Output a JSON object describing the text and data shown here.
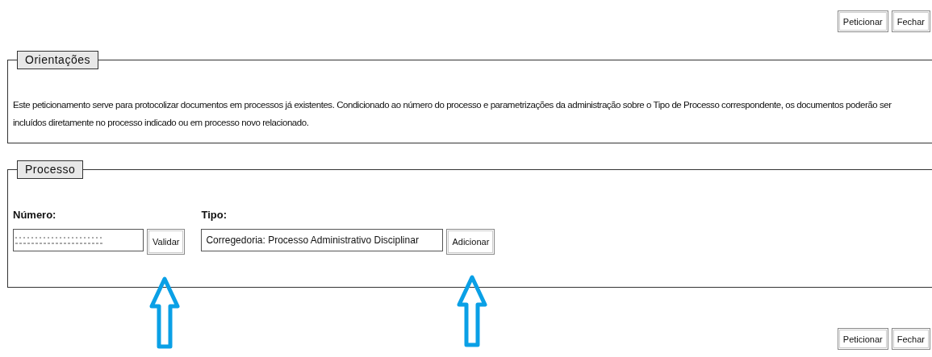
{
  "top_actions": [
    {
      "label": "Peticionar"
    },
    {
      "label": "Fechar"
    }
  ],
  "orientacoes": {
    "legend": "Orientações",
    "text": "Este peticionamento serve para protocolizar documentos em processos já existentes. Condicionado ao número do processo e parametrizações da administração sobre o Tipo de Processo correspondente, os documentos poderão ser incluídos diretamente no processo indicado ou em processo novo relacionado."
  },
  "processo": {
    "legend": "Processo",
    "numero": {
      "label": "Número:",
      "button": "Validar"
    },
    "tipo": {
      "label": "Tipo:",
      "value": "Corregedoria: Processo Administrativo Disciplinar",
      "button": "Adicionar"
    }
  },
  "bottom_actions": [
    {
      "label": "Peticionar"
    },
    {
      "label": "Fechar"
    }
  ]
}
